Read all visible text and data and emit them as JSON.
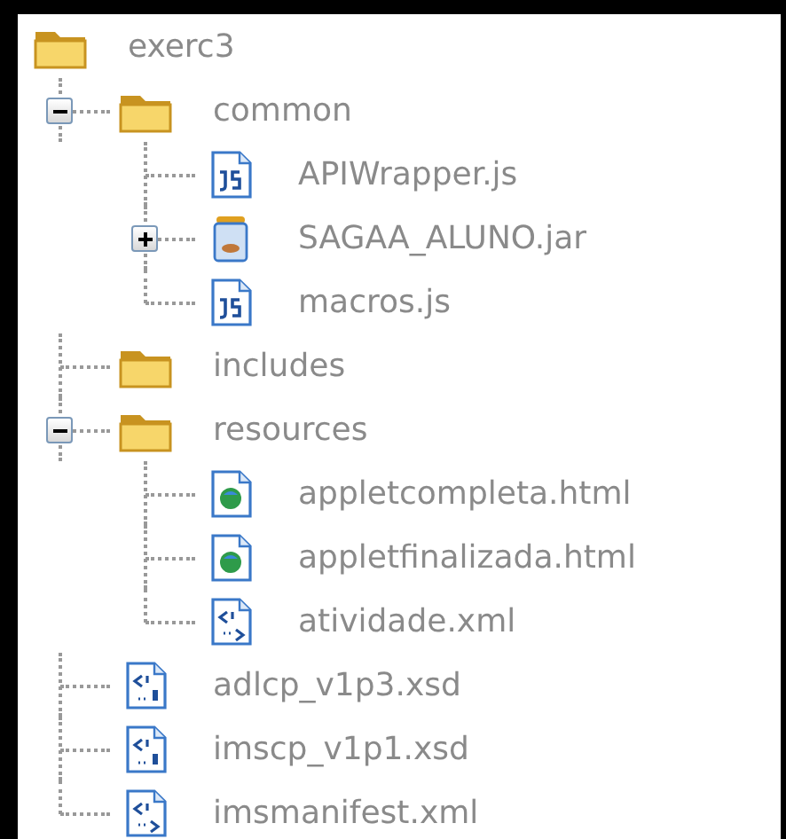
{
  "tree": [
    {
      "label": "exerc3",
      "kind": "folder",
      "children": [
        {
          "label": "common",
          "kind": "folder",
          "expanded": true,
          "children": [
            {
              "label": "APIWrapper.js",
              "kind": "js"
            },
            {
              "label": "SAGAA_ALUNO.jar",
              "kind": "jar",
              "expanded": false
            },
            {
              "label": "macros.js",
              "kind": "js"
            }
          ]
        },
        {
          "label": "includes",
          "kind": "folder"
        },
        {
          "label": "resources",
          "kind": "folder",
          "expanded": true,
          "children": [
            {
              "label": "appletcompleta.html",
              "kind": "html"
            },
            {
              "label": "appletfinalizada.html",
              "kind": "html"
            },
            {
              "label": "atividade.xml",
              "kind": "xml"
            }
          ]
        },
        {
          "label": "adlcp_v1p3.xsd",
          "kind": "xsd"
        },
        {
          "label": "imscp_v1p1.xsd",
          "kind": "xsd"
        },
        {
          "label": "imsmanifest.xml",
          "kind": "xml"
        }
      ]
    }
  ]
}
